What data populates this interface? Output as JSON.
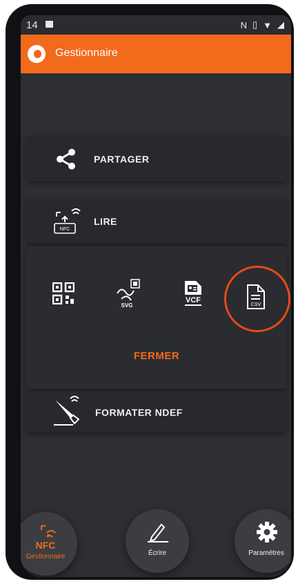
{
  "statusbar": {
    "time": "14"
  },
  "appbar": {
    "title": "Gestionnaire"
  },
  "menu": {
    "share_label": "PARTAGER",
    "read_label": "LIRE",
    "close_label": "FERMER",
    "format_label": "FORMATER NDEF"
  },
  "export": {
    "svg_text": "SVG",
    "vcf_text": "VCF",
    "csv_text": "CSV"
  },
  "icons": {
    "read_icon_text": "NFC"
  },
  "bottom_nav": {
    "nfc_text": "NFC",
    "manager_label": "Gestionnaire",
    "write_label": "Écrire",
    "settings_label": "Paramètres"
  },
  "colors": {
    "accent": "#f26a1b",
    "highlight": "#e64a19",
    "background": "#2d2f34"
  }
}
